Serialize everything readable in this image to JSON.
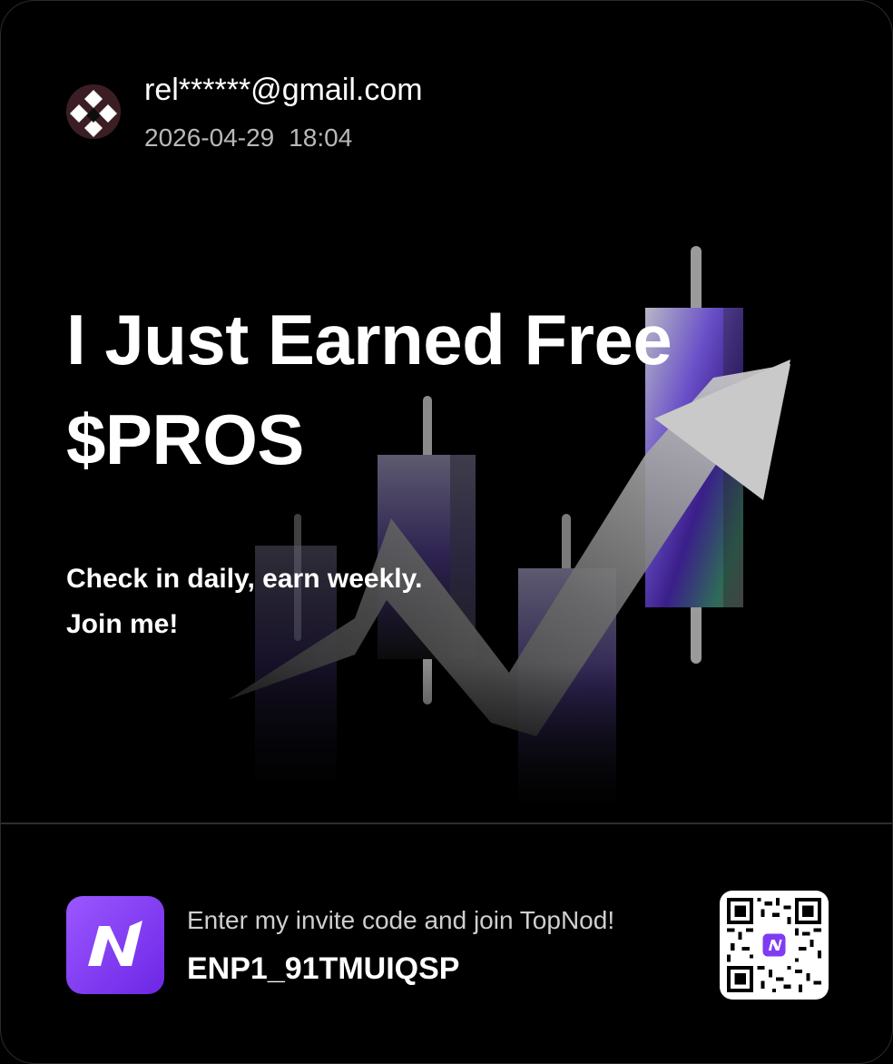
{
  "user": {
    "email": "rel******@gmail.com",
    "date": "2026-04-29",
    "time": "18:04",
    "avatar_icon": "diamond-pattern-avatar"
  },
  "headline": {
    "line1": "I Just Earned Free",
    "line2": "$PROS"
  },
  "subtext": {
    "line1": "Check in daily, earn weekly.",
    "line2": "Join me!"
  },
  "footer": {
    "invite_label": "Enter my invite code and join TopNod!",
    "invite_code": "ENP1_91TMUIQSP",
    "logo_icon": "topnod-n-logo",
    "qr_icon": "qr-code"
  },
  "colors": {
    "background": "#000000",
    "brand_purple": "#7f3cf2",
    "text_primary": "#ffffff",
    "text_secondary": "#b9b9b9"
  }
}
